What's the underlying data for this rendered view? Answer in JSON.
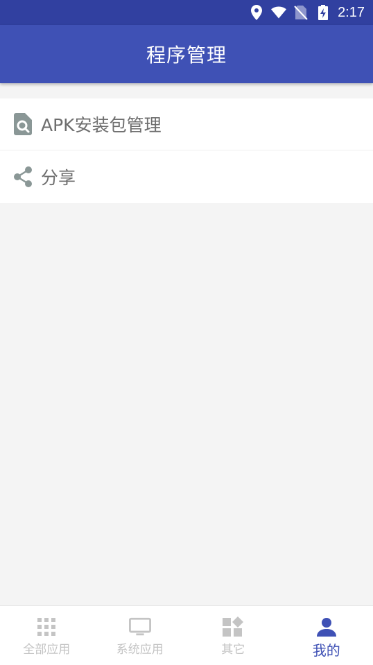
{
  "status_bar": {
    "time": "2:17",
    "icons": [
      "location-icon",
      "wifi-icon",
      "no-sim-icon",
      "battery-charging-icon"
    ]
  },
  "app_bar": {
    "title": "程序管理"
  },
  "menu": {
    "items": [
      {
        "label": "APK安装包管理",
        "icon": "apk-search-icon"
      },
      {
        "label": "分享",
        "icon": "share-icon"
      }
    ]
  },
  "bottom_nav": {
    "items": [
      {
        "label": "全部应用",
        "icon": "grid-icon",
        "active": false
      },
      {
        "label": "系统应用",
        "icon": "monitor-icon",
        "active": false
      },
      {
        "label": "其它",
        "icon": "widgets-icon",
        "active": false
      },
      {
        "label": "我的",
        "icon": "person-icon",
        "active": true
      }
    ]
  },
  "colors": {
    "status_bar": "#3140a0",
    "app_bar": "#3f51b5",
    "accent": "#3f51b5",
    "inactive": "#c4c4c4",
    "menu_icon": "#8a9796",
    "background": "#f4f4f4"
  }
}
